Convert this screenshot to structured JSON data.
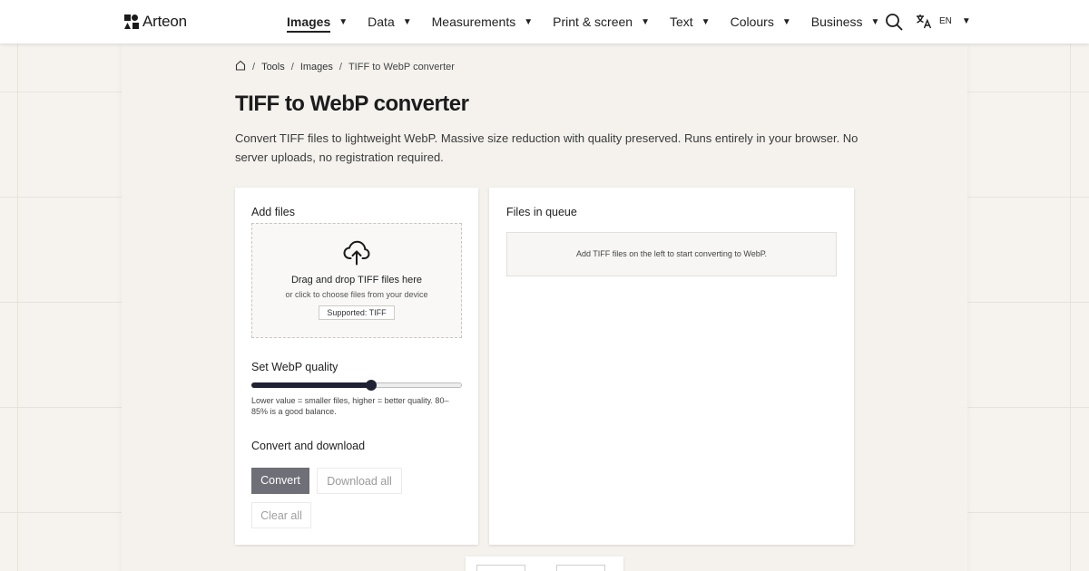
{
  "brand": {
    "name": "Arteon",
    "logo_icon": "arteon-logo-icon"
  },
  "nav": [
    {
      "label": "Images",
      "active": true
    },
    {
      "label": "Data",
      "active": false
    },
    {
      "label": "Measurements",
      "active": false
    },
    {
      "label": "Print & screen",
      "active": false
    },
    {
      "label": "Text",
      "active": false
    },
    {
      "label": "Colours",
      "active": false
    },
    {
      "label": "Business",
      "active": false
    }
  ],
  "nav_caret": "▼",
  "header_tools": {
    "search_icon": "search-icon",
    "language_icon": "translate-icon",
    "language": "EN"
  },
  "breadcrumb": {
    "home_icon": "home-icon",
    "separator": "/",
    "items": [
      "Tools",
      "Images"
    ],
    "current": "TIFF to WebP converter"
  },
  "page": {
    "title": "TIFF to WebP converter",
    "description": "Convert TIFF files to lightweight WebP. Massive size reduction with quality preserved. Runs entirely in your browser. No server uploads, no registration required."
  },
  "add_files": {
    "title": "Add files",
    "upload_icon": "cloud-upload-icon",
    "drop_text": "Drag and drop TIFF files here",
    "click_text": "or click to choose files from your device",
    "supported": "Supported: TIFF"
  },
  "quality": {
    "title": "Set WebP quality",
    "value_fraction": 0.57,
    "hint": "Lower value = smaller files, higher = better quality. 80–85% is a good balance."
  },
  "convert": {
    "title": "Convert and download",
    "convert_label": "Convert",
    "download_label": "Download all",
    "clear_label": "Clear all"
  },
  "queue": {
    "title": "Files in queue",
    "empty_text": "Add TIFF files on the left to start converting to WebP."
  },
  "colors": {
    "accent": "#1e2233",
    "button_primary": "#6f6f78",
    "background": "#f6f3ef"
  }
}
